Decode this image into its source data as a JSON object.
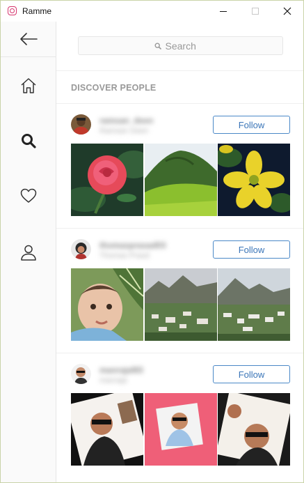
{
  "window": {
    "title": "Ramme",
    "controls": [
      "minimize",
      "maximize",
      "close"
    ]
  },
  "sidebar": {
    "items": [
      {
        "name": "back",
        "icon": "arrow-left-icon"
      },
      {
        "name": "home",
        "icon": "home-icon"
      },
      {
        "name": "explore",
        "icon": "search-icon",
        "active": true
      },
      {
        "name": "activity",
        "icon": "heart-icon"
      },
      {
        "name": "profile",
        "icon": "user-icon"
      }
    ]
  },
  "search": {
    "placeholder": "Search",
    "icon": "search-icon"
  },
  "discover": {
    "title": "DISCOVER PEOPLE",
    "follow_color": "#3a75b8",
    "people": [
      {
        "username": "ramsan_deen",
        "subtitle": "Ramsan Deen",
        "follow_label": "Follow",
        "photos": [
          "red-rose",
          "green-hill",
          "yellow-flower"
        ]
      },
      {
        "username": "thomasprasad03",
        "subtitle": "Thomas Prasd",
        "follow_label": "Follow",
        "photos": [
          "baby-portrait",
          "valley-town",
          "valley-town-wide"
        ]
      },
      {
        "username": "manrajal83",
        "subtitle": "manraja",
        "follow_label": "Follow",
        "photos": [
          "man-sunglasses-collage",
          "man-photo-pink",
          "man-sunglasses-collage-2"
        ]
      }
    ]
  }
}
